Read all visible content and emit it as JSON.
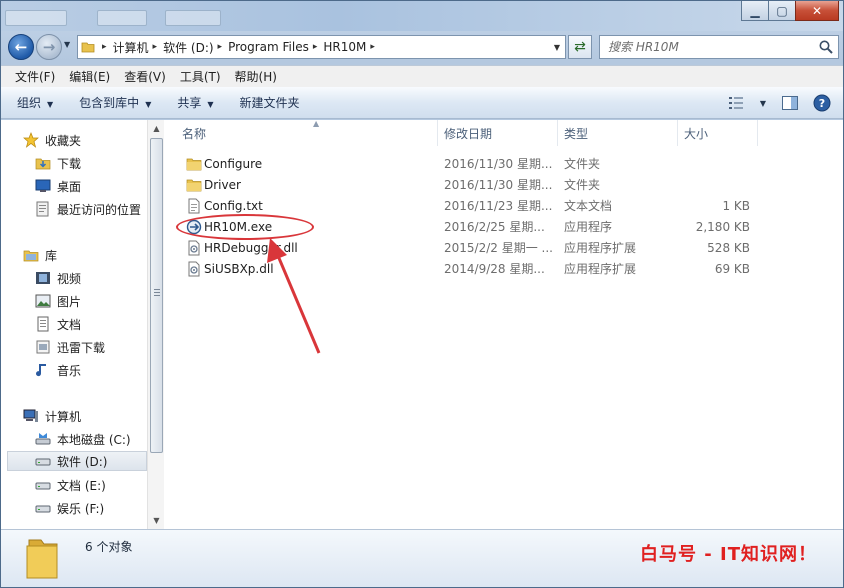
{
  "window": {
    "title_ghost_tabs": [
      "",
      "",
      ""
    ],
    "controls": {
      "minimize": "▁",
      "maximize": "▢",
      "close": "✕"
    }
  },
  "address": {
    "crumbs": [
      "计算机",
      "软件 (D:)",
      "Program Files",
      "HR10M"
    ],
    "separator": "▸"
  },
  "search": {
    "placeholder": "搜索 HR10M",
    "icon": "search-icon"
  },
  "menubar": {
    "items": [
      "文件(F)",
      "编辑(E)",
      "查看(V)",
      "工具(T)",
      "帮助(H)"
    ]
  },
  "toolbar": {
    "organize": "组织",
    "include_in_library": "包含到库中",
    "share": "共享",
    "new_folder": "新建文件夹"
  },
  "sidebar": {
    "favorites": {
      "header": "收藏夹",
      "items": [
        "下载",
        "桌面",
        "最近访问的位置"
      ]
    },
    "libraries": {
      "header": "库",
      "items": [
        "视频",
        "图片",
        "文档",
        "迅雷下载",
        "音乐"
      ]
    },
    "computer": {
      "header": "计算机",
      "items": [
        "本地磁盘 (C:)",
        "软件 (D:)",
        "文档 (E:)",
        "娱乐 (F:)"
      ],
      "selected": "软件 (D:)"
    }
  },
  "columns": {
    "name": "名称",
    "date": "修改日期",
    "type": "类型",
    "size": "大小"
  },
  "files": [
    {
      "name": "Configure",
      "date": "2016/11/30 星期...",
      "type": "文件夹",
      "size": "",
      "icon": "folder-icon"
    },
    {
      "name": "Driver",
      "date": "2016/11/30 星期...",
      "type": "文件夹",
      "size": "",
      "icon": "folder-icon"
    },
    {
      "name": "Config.txt",
      "date": "2016/11/23 星期...",
      "type": "文本文档",
      "size": "1 KB",
      "icon": "text-file-icon"
    },
    {
      "name": "HR10M.exe",
      "date": "2016/2/25 星期...",
      "type": "应用程序",
      "size": "2,180 KB",
      "icon": "exe-icon"
    },
    {
      "name": "HRDebugger.dll",
      "date": "2015/2/2 星期一 ...",
      "type": "应用程序扩展",
      "size": "528 KB",
      "icon": "dll-icon"
    },
    {
      "name": "SiUSBXp.dll",
      "date": "2014/9/28 星期...",
      "type": "应用程序扩展",
      "size": "69 KB",
      "icon": "dll-icon"
    }
  ],
  "highlighted_file": "HR10M.exe",
  "details": {
    "count": "6 个对象"
  },
  "watermark": "白马号 - IT知识网！",
  "colors": {
    "annotation": "#d9363a",
    "folder": "#e8c24e",
    "selection": "#dde4ec"
  }
}
